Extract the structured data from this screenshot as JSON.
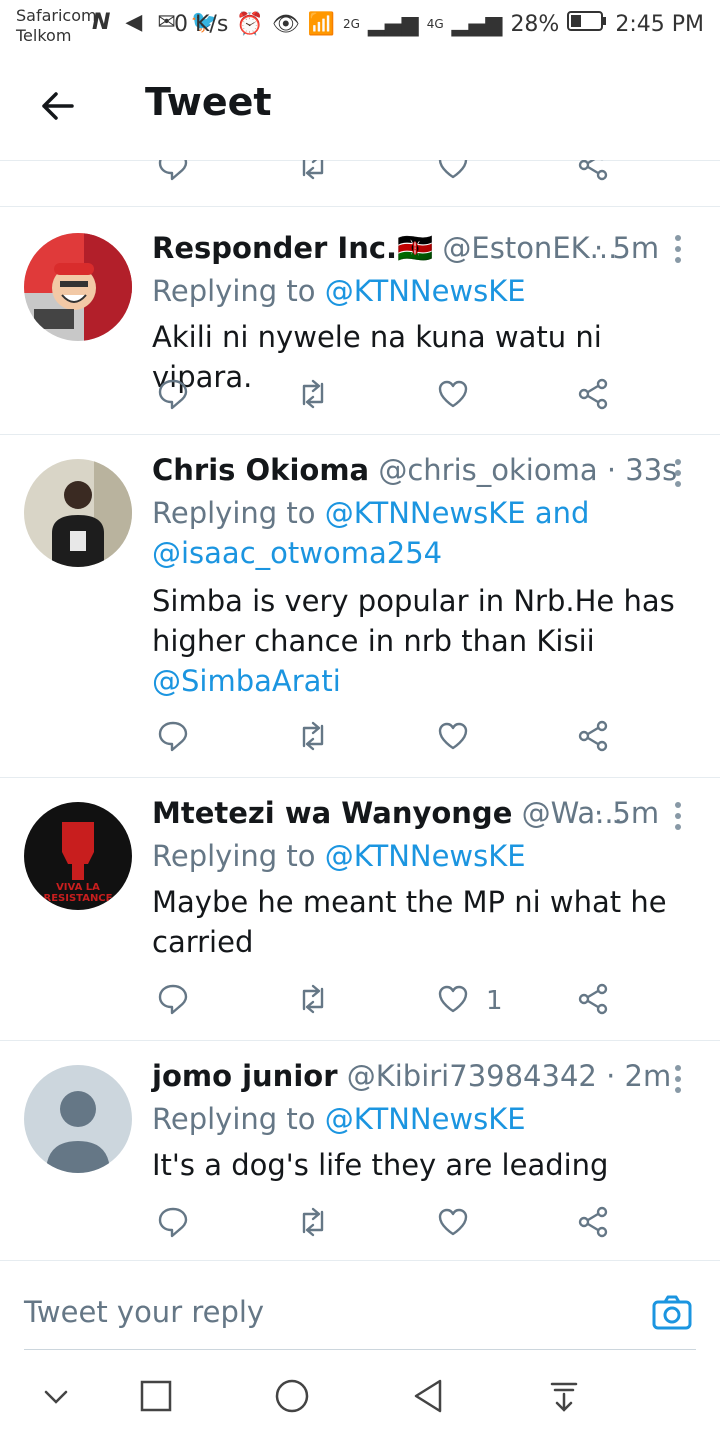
{
  "status": {
    "carrier1": "Safaricom",
    "carrier2": "Telkom",
    "speed": "0 K/s",
    "net1": "2G",
    "net2": "4G",
    "battery": "28%",
    "time": "2:45 PM"
  },
  "header": {
    "title": "Tweet"
  },
  "tweets": [
    {
      "name": "Responder Inc.🇰🇪",
      "handle": "@EstonEK...",
      "time": "· 5m",
      "replying_prefix": "Replying to",
      "replying_to": "@KTNNewsKE",
      "replying_more": "",
      "text": "Akili ni nywele na kuna watu ni vipara.",
      "likes": ""
    },
    {
      "name": "Chris Okioma",
      "handle": "@chris_okioma",
      "time": "· 33s",
      "replying_prefix": "Replying to",
      "replying_to": "@KTNNewsKE and",
      "replying_more": "@isaac_otwoma254",
      "text": "Simba is very popular in Nrb.He has higher chance in nrb than Kisii",
      "text_mention": "@SimbaArati",
      "likes": ""
    },
    {
      "name": "Mtetezi wa Wanyonge",
      "handle": "@Wa...",
      "time": "· 5m",
      "replying_prefix": "Replying to",
      "replying_to": "@KTNNewsKE",
      "replying_more": "",
      "text": "Maybe he meant the MP ni what he carried",
      "likes": "1",
      "avatar_text1": "VIVA LA",
      "avatar_text2": "RESISTANCE"
    },
    {
      "name": "jomo junior",
      "handle": "@Kibiri73984342",
      "time": "· 2m",
      "replying_prefix": "Replying to",
      "replying_to": "@KTNNewsKE",
      "replying_more": "",
      "text": "It's a dog's life they are leading",
      "likes": ""
    }
  ],
  "reply": {
    "placeholder": "Tweet your reply"
  },
  "colors": {
    "accent": "#1b95e0",
    "muted": "#657786",
    "text": "#14171a",
    "border": "#e6ecf0"
  },
  "icons": [
    "back-arrow-icon",
    "reply-icon",
    "retweet-icon",
    "like-icon",
    "share-icon",
    "more-icon",
    "camera-icon",
    "nav-down-icon",
    "nav-square-icon",
    "nav-circle-icon",
    "nav-back-icon",
    "nav-notification-icon"
  ]
}
